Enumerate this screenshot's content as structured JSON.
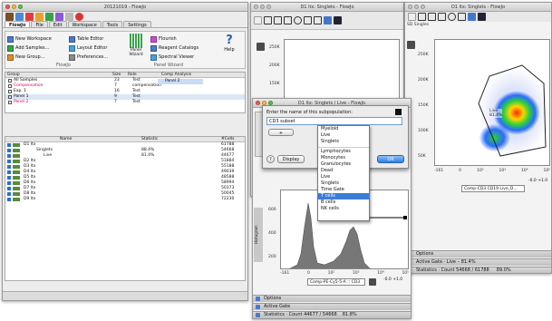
{
  "flowjo": {
    "title": "20121019 - FlowJo",
    "menu": [
      "FlowJo",
      "File",
      "Edit",
      "Workspace",
      "Tools",
      "Settings"
    ],
    "ribbon": {
      "new_workspace": "New Workspace",
      "table_editor": "Table Editor",
      "add_samples": "Add Samples...",
      "layout_editor": "Layout Editor",
      "new_group": "New Group...",
      "preferences": "Preferences...",
      "panel_wizard": "Panel Wizard",
      "flourish": "Flourish",
      "reagent_catalogs": "Reagent Catalogs",
      "spectral_viewer": "Spectral Viewer",
      "help": "Help",
      "cap_flowjo": "FlowJo",
      "cap_panel": "Panel Wizard"
    },
    "groups_header": {
      "group": "Group",
      "size": "Size",
      "role": "Role",
      "comp": "Comp Analysis"
    },
    "groups": [
      {
        "name": "All Samples",
        "size": "23",
        "role": "Test",
        "color": "#000000"
      },
      {
        "name": "Compensation",
        "size": "7",
        "role": "compensation",
        "color": "#d8005a"
      },
      {
        "name": "Exp. 1",
        "size": "16",
        "role": "Test",
        "color": "#000000"
      },
      {
        "name": "Panel 1",
        "size": "9",
        "role": "Test",
        "color": "#000000"
      },
      {
        "name": "Panel 2",
        "size": "7",
        "role": "Test",
        "color": "#d8005a"
      }
    ],
    "comp_item": "Panel 2",
    "samples_header": {
      "name": "Name",
      "statistic": "Statistic",
      "cells": "#Cells"
    },
    "samples": [
      {
        "name": "D1 ltx",
        "stat": "",
        "cells": "61788"
      },
      {
        "name": "Singlets",
        "stat": "88.4%",
        "cells": "54668"
      },
      {
        "name": "Live",
        "stat": "81.4%",
        "cells": "44677"
      },
      {
        "name": "D2 ltx",
        "stat": "",
        "cells": "51884"
      },
      {
        "name": "D3 ltx",
        "stat": "",
        "cells": "55188"
      },
      {
        "name": "D4 ltx",
        "stat": "",
        "cells": "49039"
      },
      {
        "name": "D5 ltx",
        "stat": "",
        "cells": "48588"
      },
      {
        "name": "D6 ltx",
        "stat": "",
        "cells": "58994"
      },
      {
        "name": "D7 ltx",
        "stat": "",
        "cells": "50373"
      },
      {
        "name": "D8 ltx",
        "stat": "",
        "cells": "50045"
      },
      {
        "name": "D9 ltx",
        "stat": "",
        "cells": "72230"
      }
    ]
  },
  "graph_left": {
    "title": "D1 ltx: Singlets - FlowJo",
    "y_ticks": [
      "250K",
      "200K",
      "150K",
      "100K"
    ],
    "partial_y": "S2"
  },
  "graph_right": {
    "title": "D1 ltx: Singlets - FlowJo",
    "breadcrumb": "SD Singles",
    "y_ticks": [
      "250K",
      "200K",
      "150K",
      "100K",
      "50K"
    ],
    "x_ticks": [
      "-161",
      "0",
      "10²",
      "10³",
      "10⁴",
      "10⁵"
    ],
    "x_axis": "Comp-CD3 CD19 Live_D...",
    "gate_label": "Live\n81.4%",
    "options": "Options",
    "active_gate": "Active Gate · Live – 81.4%",
    "statistics": "Statistics · Count 54668 / 61788",
    "pct": "89.0%",
    "x_extra": "-0.0 +1.0"
  },
  "graph_front": {
    "title": "D1 ltx: Singlets / Live - FlowJo",
    "y_ticks": [
      "600",
      "400",
      "200"
    ],
    "x_ticks": [
      "-161",
      "0",
      "10²",
      "10³",
      "10⁴",
      "10⁵"
    ],
    "x_axis": "Comp-PE-Cy5-5-A :: CD3",
    "x_note": "-0.0 +1.0",
    "y_axis": "Histogram",
    "left_partial": "-401, -161",
    "options": "Options",
    "active_gate": "Active Gate",
    "statistics": "Statistics · Count 44677 / 54668",
    "pct": "81.8%"
  },
  "dialog": {
    "prompt": "Enter the name of this subpopulation:",
    "value": "CD3 subset",
    "display": "Display",
    "ok": "OK",
    "help": "?"
  },
  "dropdown": {
    "items": [
      "Myeloid",
      "Live",
      "Singlets",
      "SEP",
      "Lymphocytes",
      "Monocytes",
      "Granulocytes",
      "Dead",
      "Live",
      "Singlets",
      "Time Gate",
      "T cells",
      "B cells",
      "NK cells"
    ],
    "selected_index": 11
  },
  "colors": {
    "accent": "#3d7bd9",
    "magenta": "#d8005a",
    "gate": "#222222"
  }
}
